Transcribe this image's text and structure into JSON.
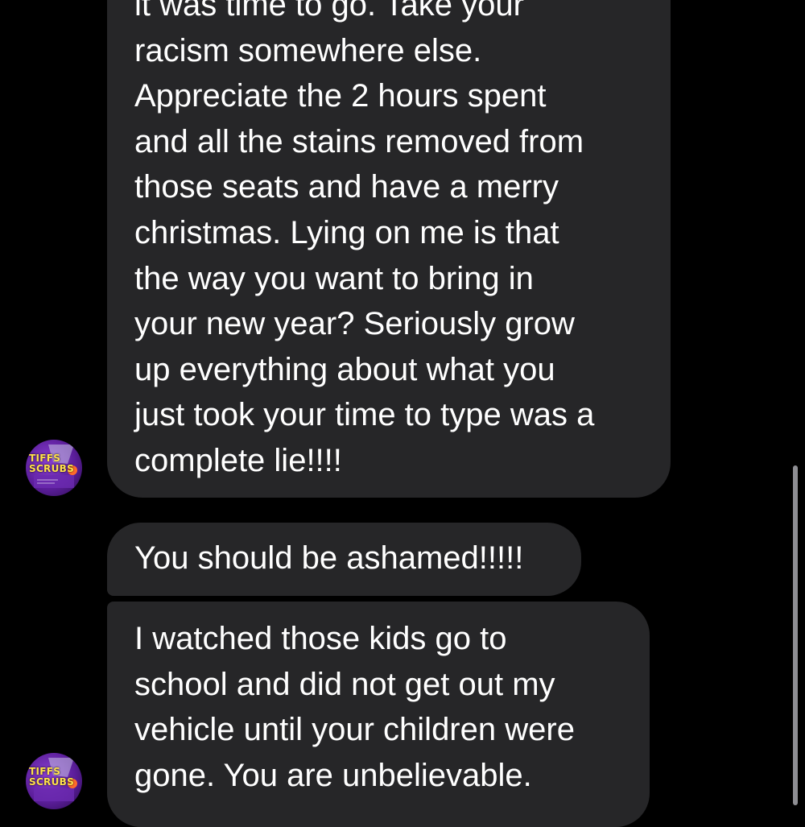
{
  "messages": [
    {
      "lines": [
        "it was time to go. Take your",
        "racism somewhere else.",
        "Appreciate the 2 hours spent",
        "and all the stains removed from",
        "those seats and have a merry",
        "christmas. Lying on me is that",
        "the way you want to bring in",
        "your new year? Seriously grow",
        "up everything about what you",
        "just took your time to type was a",
        "complete lie!!!!"
      ]
    },
    {
      "text": "You should be ashamed!!!!!"
    },
    {
      "lines": [
        "I watched those kids go to",
        "school and did not get out my",
        "vehicle until your children were",
        "gone. You are unbelievable."
      ]
    }
  ],
  "avatar": {
    "text_line1": "TIFFS",
    "text_line2": "SCRUBS",
    "icon": "profile-avatar-icon"
  },
  "colors": {
    "background": "#000000",
    "bubble": "#262628",
    "text": "#ffffff",
    "scrollbar": "#8e8e93"
  }
}
